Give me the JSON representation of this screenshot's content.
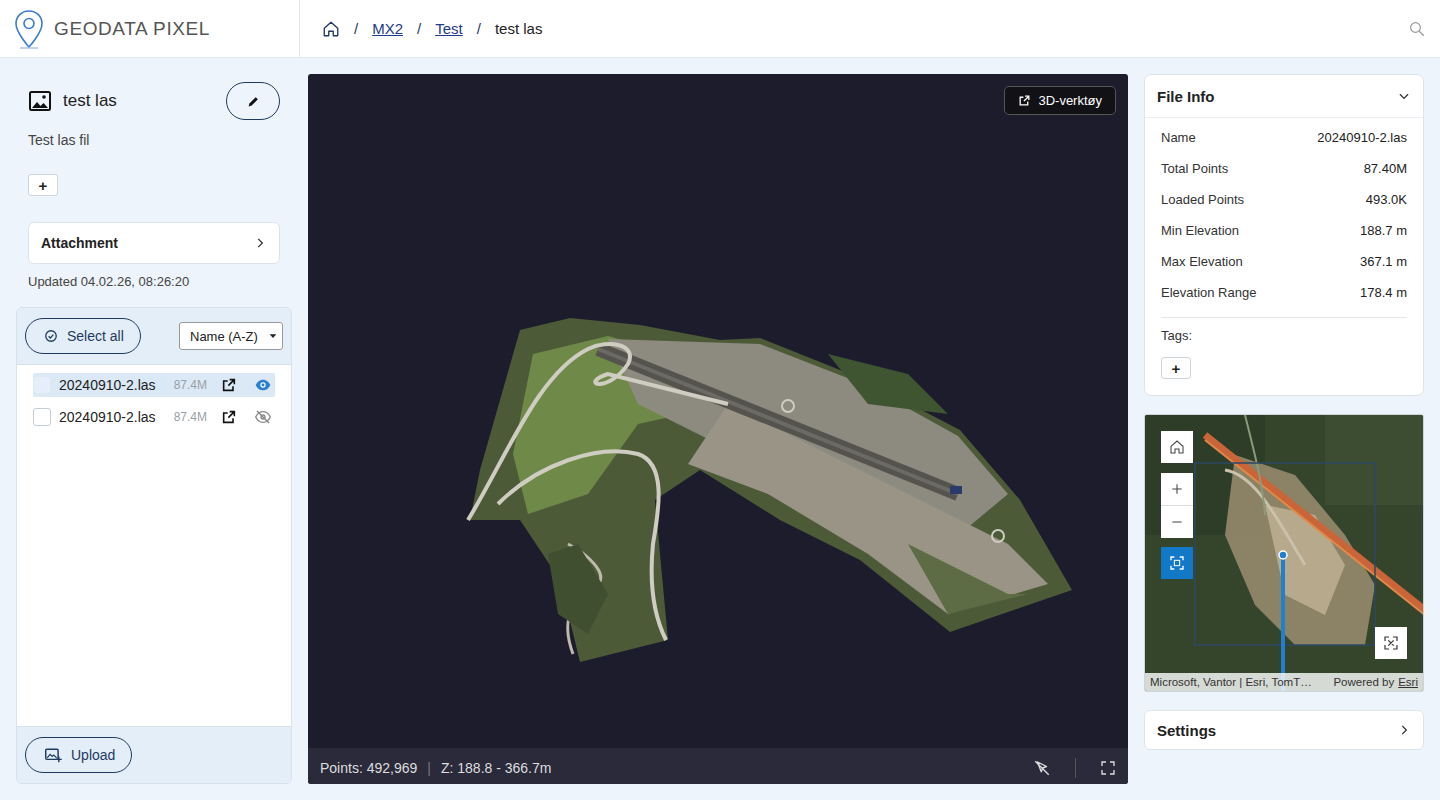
{
  "app": {
    "logo": "GEODATA PIXEL"
  },
  "breadcrumb_separator": "/",
  "breadcrumb": [
    {
      "label": "MX2",
      "link": true
    },
    {
      "label": "Test",
      "link": true
    },
    {
      "label": "test las",
      "link": false
    }
  ],
  "item": {
    "title": "test las",
    "description": "Test las fil",
    "add": "+",
    "attachment": "Attachment",
    "updated": "Updated 04.02.26, 08:26:20"
  },
  "files": {
    "select_all": "Select all",
    "sort": "Name (A-Z)",
    "rows": [
      {
        "name": "20240910-2.las",
        "size": "87.4M",
        "checked": false,
        "selected": true,
        "visible": true
      },
      {
        "name": "20240910-2.las",
        "size": "87.4M",
        "checked": false,
        "selected": false,
        "visible": false
      }
    ],
    "upload": "Upload"
  },
  "viewer": {
    "tool_button": "3D-verktøy",
    "points": "Points: 492,969",
    "separator": "|",
    "range": "Z: 188.8 - 366.7m"
  },
  "file_info": {
    "title": "File Info",
    "expanded": true,
    "rows": [
      {
        "label": "Name",
        "value": "20240910-2.las"
      },
      {
        "label": "Total Points",
        "value": "87.40M"
      },
      {
        "label": "Loaded Points",
        "value": "493.0K"
      },
      {
        "label": "Min Elevation",
        "value": "188.7 m"
      },
      {
        "label": "Max Elevation",
        "value": "367.1 m"
      },
      {
        "label": "Elevation Range",
        "value": "178.4 m"
      }
    ],
    "tags_label": "Tags:",
    "add_tag": "+"
  },
  "map": {
    "attribution": "Microsoft, Vantor | Esri, TomT…",
    "powered_by": "Powered by",
    "provider": "Esri",
    "select_active": true
  },
  "settings": {
    "title": "Settings"
  }
}
